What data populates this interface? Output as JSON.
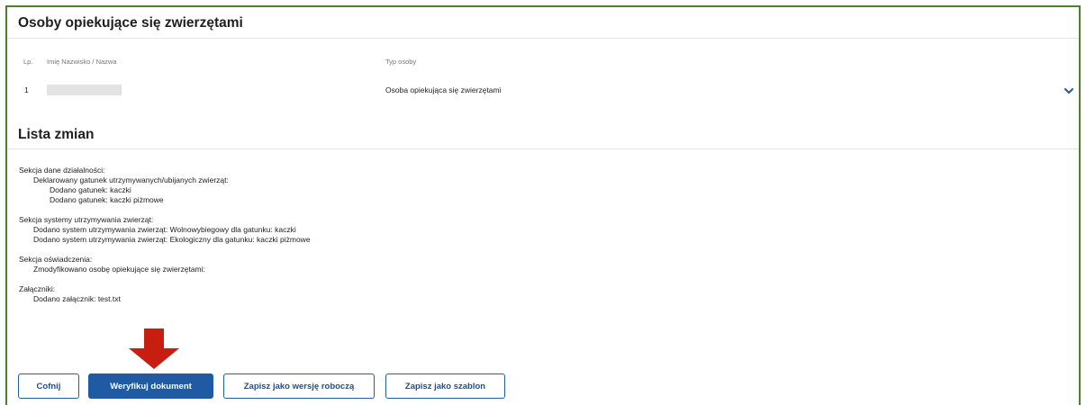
{
  "caretakers": {
    "title": "Osoby opiekujące się zwierzętami",
    "columns": {
      "lp": "Lp.",
      "name": "Imię Nazwisko / Nazwa",
      "type": "Typ osoby"
    },
    "rows": [
      {
        "lp": "1",
        "type": "Osoba opiekująca się zwierzętami"
      }
    ],
    "expand_icon": "chevron-down-icon"
  },
  "changes": {
    "title": "Lista zmian",
    "lines": [
      {
        "text": "Sekcja dane działalności:",
        "indent": 0
      },
      {
        "text": "Deklarowany gatunek utrzymywanych/ubijanych zwierząt:",
        "indent": 1
      },
      {
        "text": "Dodano gatunek: kaczki",
        "indent": 2
      },
      {
        "text": "Dodano gatunek: kaczki piżmowe",
        "indent": 2
      },
      {
        "text": "",
        "indent": -1
      },
      {
        "text": "Sekcja systemy utrzymywania zwierząt:",
        "indent": 0
      },
      {
        "text": "Dodano system utrzymywania zwierząt: Wolnowybiegowy dla gatunku: kaczki",
        "indent": 1
      },
      {
        "text": "Dodano system utrzymywania zwierząt: Ekologiczny dla gatunku: kaczki piżmowe",
        "indent": 1
      },
      {
        "text": "",
        "indent": -1
      },
      {
        "text": "Sekcja oświadczenia:",
        "indent": 0
      },
      {
        "text": "Zmodyfikowano osobę opiekujące się zwierzętami:",
        "indent": 1
      },
      {
        "text": "",
        "indent": -1
      },
      {
        "text": "Załączniki:",
        "indent": 0
      },
      {
        "text": "Dodano załącznik: test.txt",
        "indent": 1
      }
    ]
  },
  "buttons": {
    "back": "Cofnij",
    "verify": "Weryfikuj dokument",
    "save_draft": "Zapisz jako wersję roboczą",
    "save_template": "Zapisz jako szablon"
  },
  "colors": {
    "frame_border": "#4e7d2c",
    "primary": "#1f5aa3",
    "annotation_arrow": "#c81e10"
  }
}
